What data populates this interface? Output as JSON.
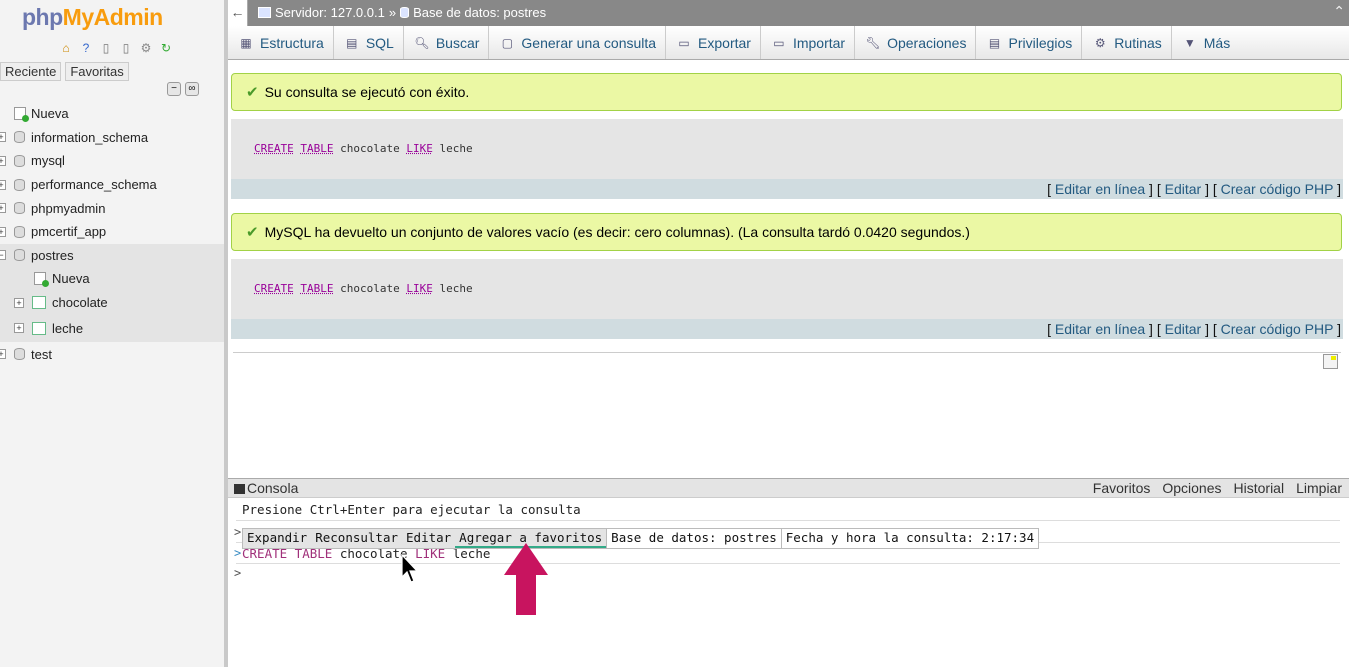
{
  "logo": {
    "php": "php",
    "my": "My",
    "admin": "Admin"
  },
  "left": {
    "recent_tab": "Reciente",
    "favorites_tab": "Favoritas",
    "new_label": "Nueva",
    "databases": [
      "information_schema",
      "mysql",
      "performance_schema",
      "phpmyadmin",
      "pmcertif_app"
    ],
    "active_db": "postres",
    "active_db_new": "Nueva",
    "tables": [
      "chocolate",
      "leche"
    ],
    "last_db": "test"
  },
  "topbar": {
    "server": "Servidor: 127.0.0.1",
    "sep": "»",
    "database": "Base de datos: postres"
  },
  "menu": [
    {
      "label": "Estructura",
      "icon": "structure-icon"
    },
    {
      "label": "SQL",
      "icon": "sql-icon"
    },
    {
      "label": "Buscar",
      "icon": "search-icon"
    },
    {
      "label": "Generar una consulta",
      "icon": "query-icon"
    },
    {
      "label": "Exportar",
      "icon": "export-icon"
    },
    {
      "label": "Importar",
      "icon": "import-icon"
    },
    {
      "label": "Operaciones",
      "icon": "wrench-icon"
    },
    {
      "label": "Privilegios",
      "icon": "privileges-icon"
    },
    {
      "label": "Rutinas",
      "icon": "routines-icon"
    },
    {
      "label": "Más",
      "icon": "chevron-down-icon"
    }
  ],
  "messages": {
    "success1": "Su consulta se ejecutó con éxito.",
    "success2": "MySQL ha devuelto un conjunto de valores vacío (es decir: cero columnas). (La consulta tardó 0.0420 segundos.)"
  },
  "sql": {
    "kw_create": "CREATE",
    "kw_table": "TABLE",
    "name": "chocolate",
    "kw_like": "LIKE",
    "src": "leche"
  },
  "sql_links": {
    "edit_inline": "Editar en línea",
    "edit": "Editar",
    "create_php": "Crear código PHP"
  },
  "console": {
    "title": "Consola",
    "options": [
      "Favoritos",
      "Opciones",
      "Historial",
      "Limpiar"
    ],
    "hint": "Presione Ctrl+Enter para ejecutar la consulta",
    "toolbar": {
      "expand": "Expandir",
      "requery": "Reconsultar",
      "edit": "Editar",
      "add_fav": "Agregar a favoritos",
      "db": "Base de datos: postres",
      "time": "Fecha y hora la consulta: 2:17:34"
    },
    "query_line": {
      "create": "CREATE TABLE",
      "name": "chocolate",
      "like": "LIKE",
      "src": "leche"
    },
    "prompt": ">"
  },
  "colors": {
    "accent_link": "#235a81",
    "success_bg": "#ebf8a4",
    "annotation_arrow": "#c8145f"
  }
}
